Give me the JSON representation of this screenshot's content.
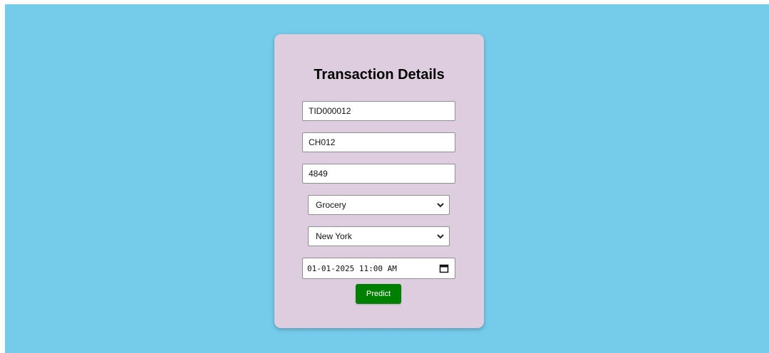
{
  "form": {
    "title": "Transaction Details",
    "transaction_id": "TID000012",
    "customer_id": "CH012",
    "amount": "4849",
    "category": "Grocery",
    "location": "New York",
    "datetime": "01-01-2025 11:00 AM",
    "submit_label": "Predict"
  },
  "colors": {
    "background": "#74cbea",
    "card": "#decddf",
    "button": "#008000",
    "button_text": "#ffffff"
  },
  "icons": {
    "select_arrow": "chevron-down-icon",
    "date_picker": "calendar-icon"
  }
}
